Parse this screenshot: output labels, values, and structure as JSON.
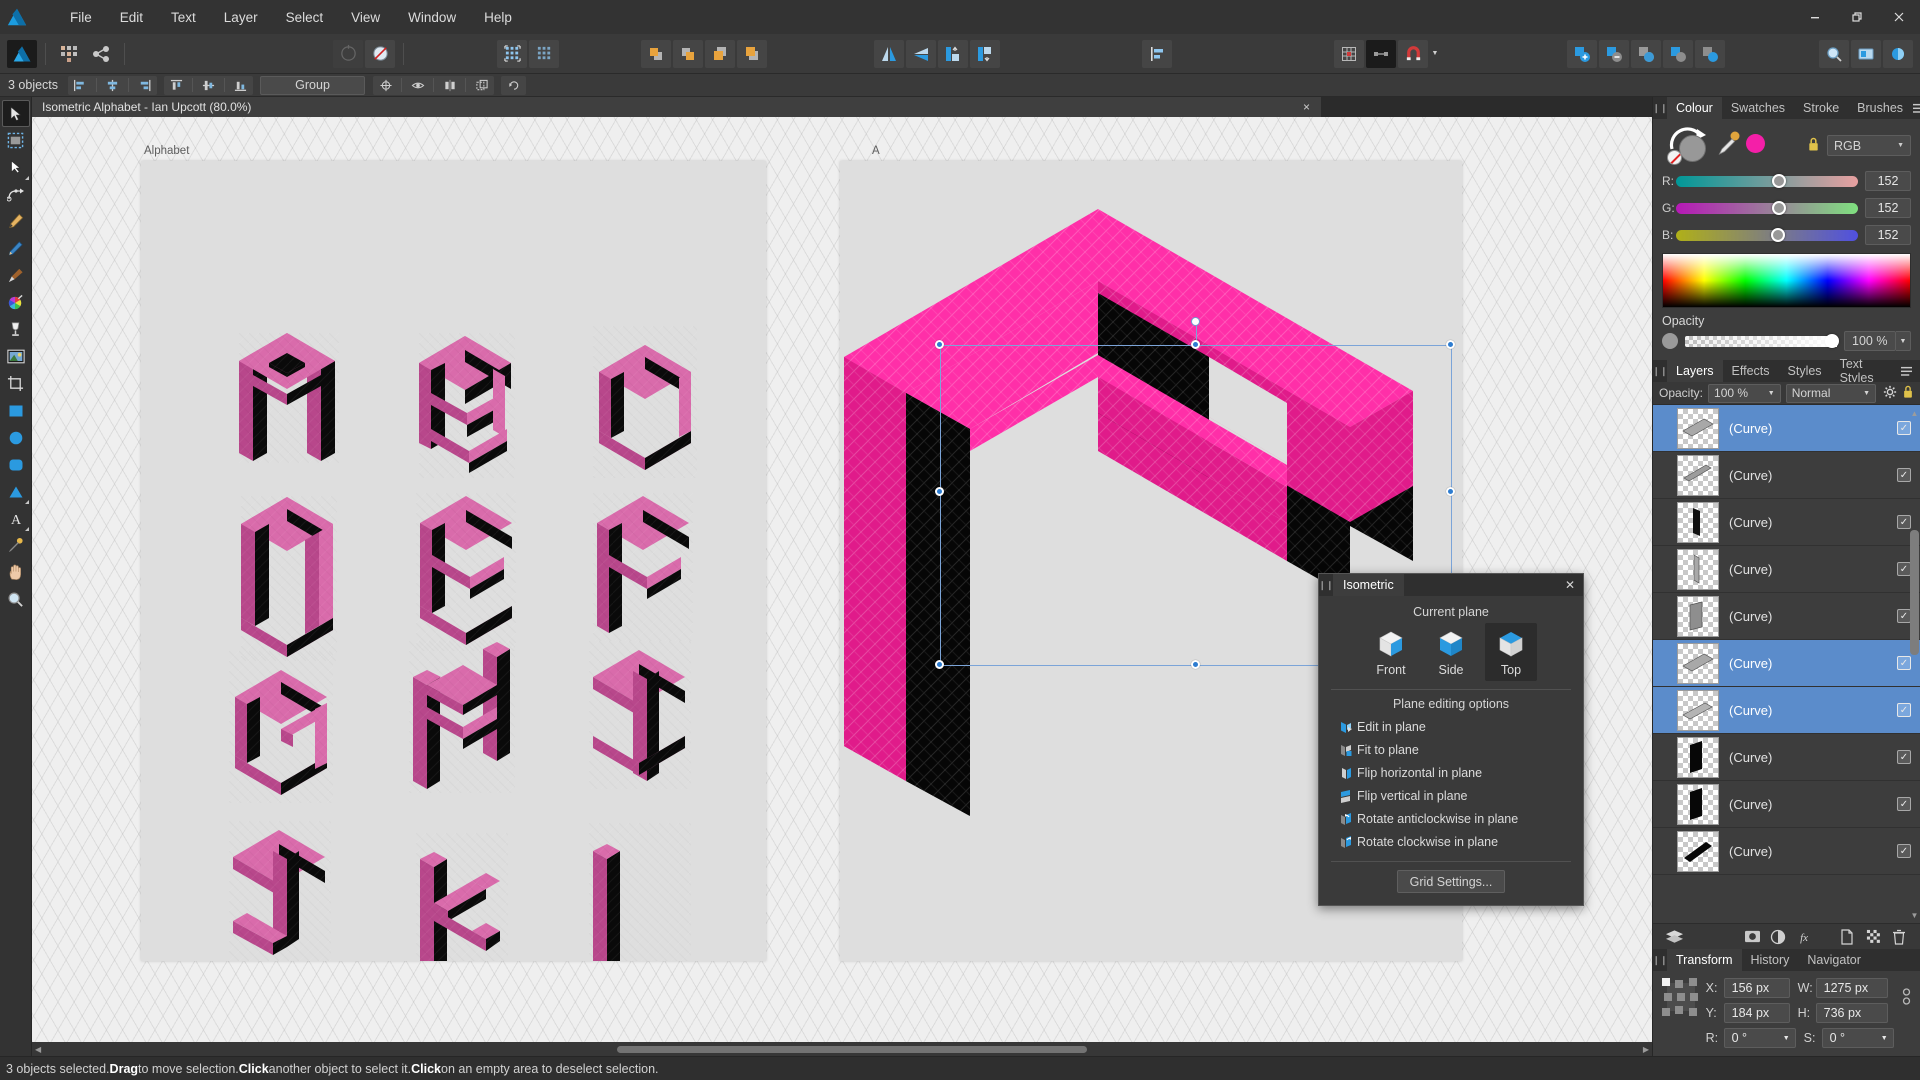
{
  "app": {
    "name": "Affinity Designer",
    "logo_icon": "affinity-designer-logo"
  },
  "menubar": {
    "items": [
      "File",
      "Edit",
      "Text",
      "Layer",
      "Select",
      "View",
      "Window",
      "Help"
    ],
    "window_controls": {
      "minimize": "minimize-icon",
      "restore": "restore-icon",
      "close": "close-icon"
    }
  },
  "toolbar": {
    "persona_buttons": [
      "designer-persona",
      "pixel-persona",
      "export-persona"
    ],
    "node_buttons": [
      "node-tool-disabled",
      "boolean-subtract"
    ],
    "grid_buttons": [
      "show-grid",
      "snap-grid"
    ],
    "arrange_buttons": [
      "move-forward-one",
      "move-back-one",
      "move-to-front",
      "move-to-back"
    ],
    "flip_buttons": [
      "flip-horizontal",
      "flip-vertical",
      "rotate-left",
      "rotate-right"
    ],
    "align_button": "align-left",
    "snap_buttons": [
      "grid-settings",
      "snapping-candidates",
      "snapping-magnet"
    ],
    "boolean_buttons": [
      "add-shape",
      "subtract-shape",
      "intersect-shape",
      "divide-shape",
      "combine-shape"
    ],
    "view_buttons": [
      "zoom-tool",
      "pan-view",
      "colour-picker"
    ]
  },
  "context_bar": {
    "object_count": "3 objects",
    "align_horizontal": [
      "align-left-icon",
      "align-centre-icon",
      "align-right-icon"
    ],
    "align_vertical": [
      "align-top-icon",
      "align-middle-icon",
      "align-bottom-icon"
    ],
    "align_to_dropdown": "Group",
    "extra_buttons": [
      "centre-pivot-icon",
      "show-hide-icon",
      "mirror-icon",
      "duplicate-icon"
    ],
    "last_button": "reset-icon"
  },
  "tools": [
    "move-tool",
    "artboard-tool",
    "node-tool",
    "corner-tool",
    "pen-tool",
    "pencil-tool",
    "vector-brush-tool",
    "colour-wheel-tool",
    "fill-tool",
    "place-image-tool",
    "crop-tool",
    "rectangle-tool",
    "ellipse-tool",
    "rounded-rectangle-tool",
    "triangle-tool",
    "text-tool",
    "eyedropper-tool",
    "hand-tool",
    "zoom-tool"
  ],
  "document": {
    "tab_title": "Isometric Alphabet - Ian Upcott (80.0%)",
    "close_label": "×",
    "zoom": "80.0%",
    "artboards": [
      {
        "label": "Alphabet",
        "letters": [
          "A",
          "B",
          "C",
          "D",
          "E",
          "F",
          "G",
          "H",
          "I",
          "J",
          "K",
          "L"
        ]
      },
      {
        "label": "A",
        "letters": [
          "A"
        ]
      }
    ]
  },
  "colour_panel": {
    "tabs": [
      "Colour",
      "Swatches",
      "Stroke",
      "Brushes"
    ],
    "active_tab": "Colour",
    "model": "RGB",
    "channels": [
      {
        "label": "R:",
        "value": "152"
      },
      {
        "label": "G:",
        "value": "152"
      },
      {
        "label": "B:",
        "value": "152"
      }
    ],
    "fill_colour": "#f41fa8",
    "stroke_colour": "#989898",
    "opacity_label": "Opacity",
    "opacity_value": "100 %",
    "icons": [
      "swap-colours-icon",
      "none-colour-icon",
      "eyedropper-icon",
      "lock-icon",
      "panel-menu-icon"
    ]
  },
  "layers_panel": {
    "tabs": [
      "Layers",
      "Effects",
      "Styles",
      "Text Styles"
    ],
    "active_tab": "Layers",
    "opacity_label": "Opacity:",
    "opacity_value": "100 %",
    "blend_mode": "Normal",
    "header_icons": [
      "gear-icon",
      "lock-icon"
    ],
    "rows": [
      {
        "name": "(Curve)",
        "selected": true,
        "thumb": "diagonal-bar-grey",
        "visible": true
      },
      {
        "name": "(Curve)",
        "selected": false,
        "thumb": "thin-diagonal-grey",
        "visible": true
      },
      {
        "name": "(Curve)",
        "selected": false,
        "thumb": "vertical-bar-black",
        "visible": true
      },
      {
        "name": "(Curve)",
        "selected": false,
        "thumb": "vertical-bar-grey",
        "visible": true
      },
      {
        "name": "(Curve)",
        "selected": false,
        "thumb": "parallelogram-grey",
        "visible": true
      },
      {
        "name": "(Curve)",
        "selected": true,
        "thumb": "diagonal-bar-grey",
        "visible": true
      },
      {
        "name": "(Curve)",
        "selected": true,
        "thumb": "diagonal-bar-grey",
        "visible": true
      },
      {
        "name": "(Curve)",
        "selected": false,
        "thumb": "parallelogram-black",
        "visible": true
      },
      {
        "name": "(Curve)",
        "selected": false,
        "thumb": "parallelogram-black",
        "visible": true
      },
      {
        "name": "(Curve)",
        "selected": false,
        "thumb": "slanted-bar-black",
        "visible": true
      }
    ],
    "footer_icons": [
      "layer-stack-icon",
      "mask-icon",
      "adjustment-icon",
      "fx-icon",
      "new-layer-icon",
      "new-pixel-layer-icon",
      "delete-layer-icon"
    ]
  },
  "transform_panel": {
    "tabs": [
      "Transform",
      "History",
      "Navigator"
    ],
    "active_tab": "Transform",
    "fields": [
      {
        "label": "X:",
        "value": "156 px"
      },
      {
        "label": "W:",
        "value": "1275 px"
      },
      {
        "label": "Y:",
        "value": "184 px"
      },
      {
        "label": "H:",
        "value": "736 px"
      },
      {
        "label": "R:",
        "value": "0 °"
      },
      {
        "label": "S:",
        "value": "0 °"
      }
    ],
    "link_icon": "link-ratio-icon"
  },
  "isometric_panel": {
    "title": "Isometric",
    "close_label": "✕",
    "current_plane_label": "Current plane",
    "planes": [
      {
        "label": "Front",
        "active": false
      },
      {
        "label": "Side",
        "active": false
      },
      {
        "label": "Top",
        "active": true
      }
    ],
    "editing_label": "Plane editing options",
    "options": [
      {
        "label": "Edit in plane",
        "icon": "edit-in-plane-icon"
      },
      {
        "label": "Fit to plane",
        "icon": "fit-to-plane-icon"
      },
      {
        "label": "Flip horizontal in plane",
        "icon": "flip-horizontal-plane-icon"
      },
      {
        "label": "Flip vertical in plane",
        "icon": "flip-vertical-plane-icon"
      },
      {
        "label": "Rotate anticlockwise in plane",
        "icon": "rotate-anticlockwise-plane-icon"
      },
      {
        "label": "Rotate clockwise in plane",
        "icon": "rotate-clockwise-plane-icon"
      }
    ],
    "grid_settings_label": "Grid Settings..."
  },
  "status_bar": {
    "prefix": "3 objects selected. ",
    "b1": "Drag",
    "t1": " to move selection. ",
    "b2": "Click",
    "t2": " another object to select it. ",
    "b3": "Click",
    "t3": " on an empty area to deselect selection."
  },
  "colors": {
    "letter_top": "#d96bab",
    "letter_left": "#b8478b",
    "letter_dark": "#0a0a0a",
    "big_top": "#ff2fa8",
    "big_left": "#e01b8a",
    "big_dark": "#060606",
    "selection_blue": "#5b8ccb",
    "canvas_bg": "#efefef",
    "artboard_bg": "#dedede"
  }
}
